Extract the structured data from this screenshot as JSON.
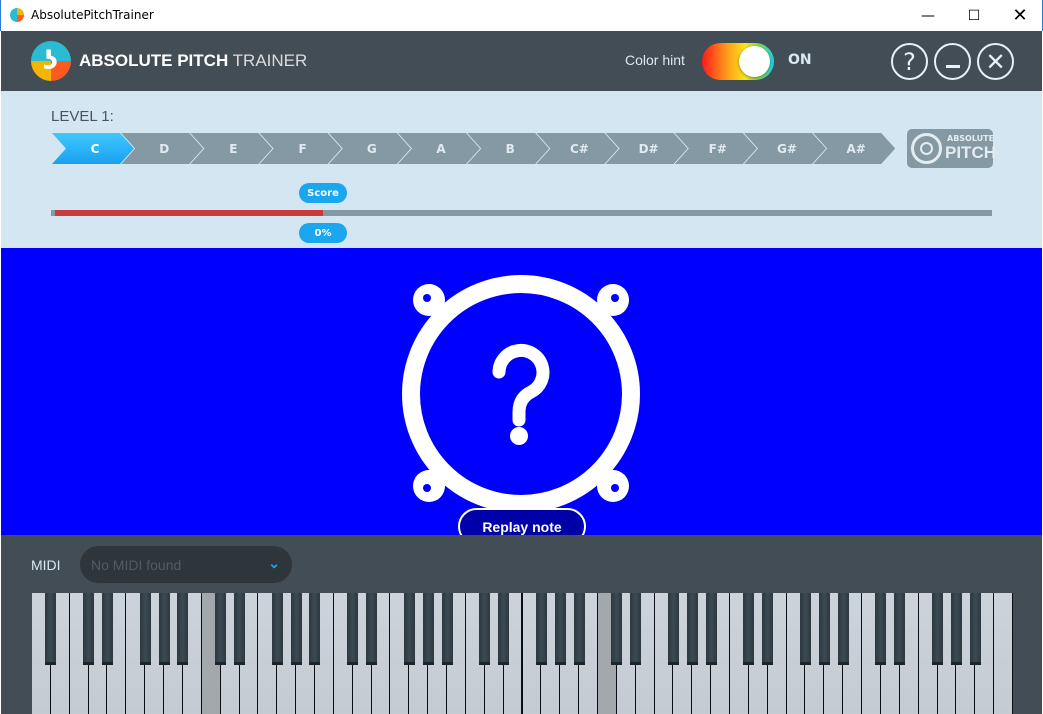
{
  "window": {
    "title": "AbsolutePitchTrainer",
    "controls": [
      "minimize",
      "maximize",
      "close"
    ]
  },
  "header": {
    "title_bold": "ABSOLUTE PITCH",
    "title_light": "TRAINER",
    "color_hint_label": "Color hint",
    "color_hint_state": "ON",
    "color_hint_on": true,
    "buttons": [
      "help-icon",
      "minimize-icon",
      "close-icon"
    ]
  },
  "level": {
    "label": "LEVEL 1:",
    "notes": [
      "C",
      "D",
      "E",
      "F",
      "G",
      "A",
      "B",
      "C#",
      "D#",
      "F#",
      "G#",
      "A#"
    ],
    "active_note": "C",
    "badge_top": "ABSOLUTE",
    "badge_bottom": "PITCH"
  },
  "score": {
    "label": "Score",
    "value_text": "0%",
    "progress_fraction": 0.285
  },
  "stage": {
    "icon": "question-speaker-icon",
    "replay_label": "Replay note"
  },
  "midi": {
    "label": "MIDI",
    "placeholder": "No MIDI found"
  },
  "piano": {
    "keys": 88,
    "lowest": "A0",
    "highlighted": [
      "C2",
      "C5"
    ]
  },
  "colors": {
    "header": "#434d55",
    "panel": "#d4e6f2",
    "stage": "#0000ff",
    "accent": "#1aa7ef",
    "score_bar": "#c93a3a"
  }
}
